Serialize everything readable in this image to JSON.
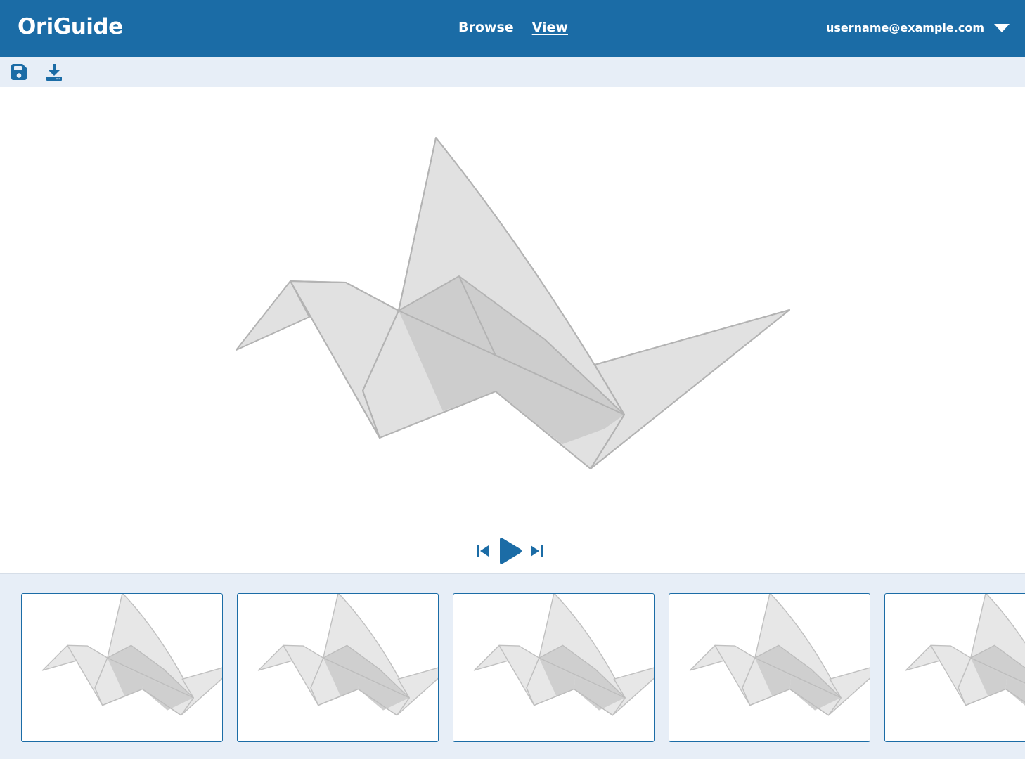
{
  "app": {
    "brand": "OriGuide",
    "nav": [
      {
        "label": "Browse",
        "active": false
      },
      {
        "label": "View",
        "active": true
      }
    ],
    "user": {
      "email": "username@example.com"
    }
  },
  "toolbar": {
    "icons": [
      "save-icon",
      "download-icon"
    ]
  },
  "player": {
    "icons": [
      "skip-to-start-icon",
      "play-icon",
      "skip-to-end-icon"
    ]
  },
  "steps": {
    "visible_count": 5
  },
  "colors": {
    "primary": "#1b6ca6",
    "toolbar_bg": "#e7eef7",
    "paper_light": "#e1e1e1",
    "paper_shade": "#cdcdcd",
    "fold_line": "#b3b3b3"
  }
}
